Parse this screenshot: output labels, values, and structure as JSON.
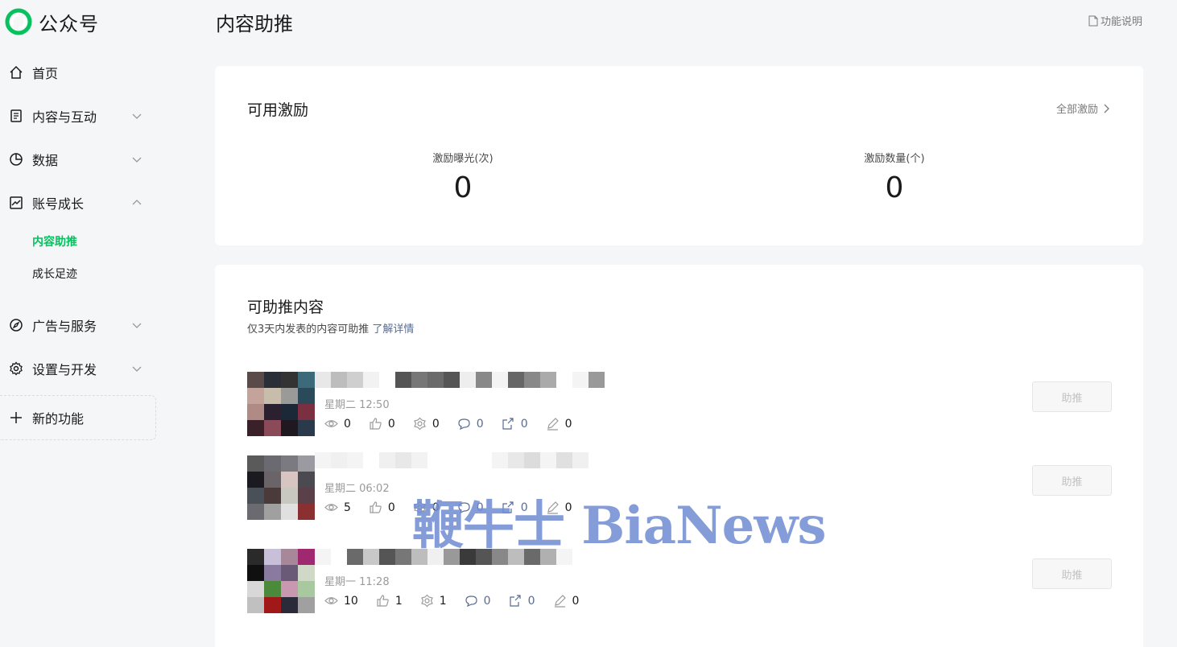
{
  "brand": {
    "name": "公众号"
  },
  "sidebar": {
    "items": [
      {
        "label": "首页",
        "icon": "home-icon"
      },
      {
        "label": "内容与互动",
        "icon": "document-icon"
      },
      {
        "label": "数据",
        "icon": "pie-chart-icon"
      },
      {
        "label": "账号成长",
        "icon": "trend-icon"
      },
      {
        "label": "广告与服务",
        "icon": "compass-icon"
      },
      {
        "label": "设置与开发",
        "icon": "gear-icon"
      }
    ],
    "sub_items": [
      {
        "label": "内容助推",
        "active": true
      },
      {
        "label": "成长足迹",
        "active": false
      }
    ],
    "new_feature": "新的功能"
  },
  "header": {
    "title": "内容助推",
    "help": "功能说明"
  },
  "incentives": {
    "title": "可用激励",
    "all_link": "全部激励",
    "stats": [
      {
        "label": "激励曝光(次)",
        "value": "0"
      },
      {
        "label": "激励数量(个)",
        "value": "0"
      }
    ]
  },
  "boost_content": {
    "title": "可助推内容",
    "desc": "仅3天内发表的内容可助推",
    "desc_link": "了解详情",
    "button_label": "助推",
    "rows": [
      {
        "time": "星期二 12:50",
        "views": "0",
        "likes": "0",
        "wows": "0",
        "comments": "0",
        "shares": "0",
        "edits": "0"
      },
      {
        "time": "星期二 06:02",
        "views": "5",
        "likes": "0",
        "wows": "0",
        "comments": "0",
        "shares": "0",
        "edits": "0"
      },
      {
        "time": "星期一 11:28",
        "views": "10",
        "likes": "1",
        "wows": "1",
        "comments": "0",
        "shares": "0",
        "edits": "0"
      }
    ]
  },
  "watermark": "鞭牛士 BiaNews",
  "colors": {
    "accent": "#07c160",
    "link": "#576b95",
    "background": "#f5f6f7"
  }
}
